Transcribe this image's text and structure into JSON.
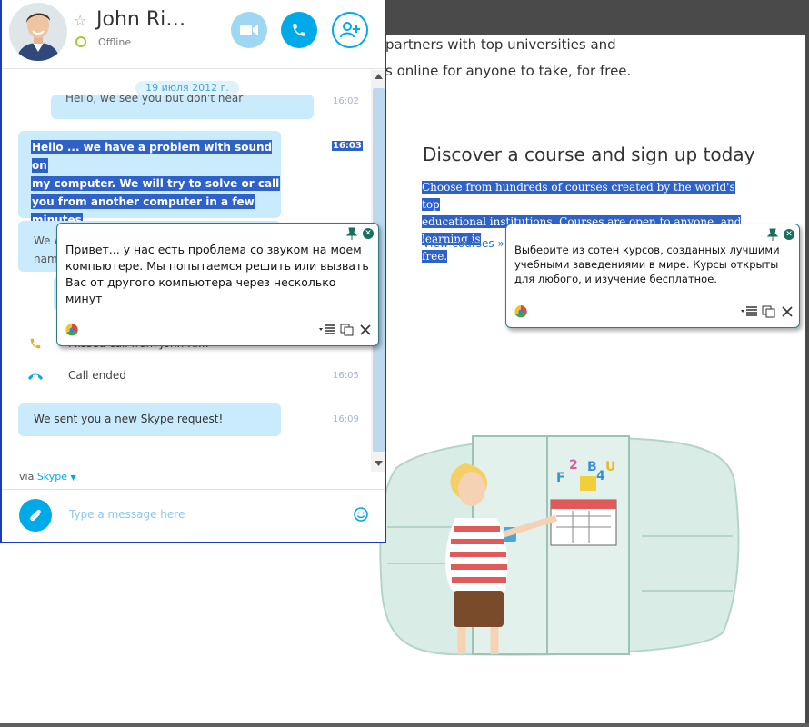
{
  "web": {
    "line1": "partners with top universities and",
    "line2": "s online for anyone to take, for free.",
    "heading": "Discover a course and sign up today",
    "description_lines": [
      "Choose from hundreds of courses created by the world's top",
      "educational institutions. Courses are open to anyone, and learning is",
      "free."
    ],
    "link": "View courses »",
    "magnet_letters": [
      "F",
      "2",
      "B",
      "4",
      "U"
    ]
  },
  "skype": {
    "contact_name": "John Ri…",
    "status": "Offline",
    "date": "19 июля 2012 г.",
    "messages": {
      "top_partial": "Hello, we see you but don't hear",
      "top_partial_time": "16:02",
      "selected_lines": [
        "Hello ... we have a problem with sound on",
        "my computer. We will try to solve or call",
        "you from another computer in a few",
        "minutes"
      ],
      "selected_time": "16:03",
      "mid_lines": [
        "We w",
        "nam"
      ],
      "call_missed": "Missed call from John Ri…",
      "call_ended": "Call ended",
      "call_ended_time": "16:05",
      "request": "We sent you a new Skype request!",
      "request_time": "16:09"
    },
    "via_prefix": "via",
    "via_link": "Skype",
    "input_placeholder": "Type a message here"
  },
  "translator": {
    "popup1_lines": [
      "Привет... у нас есть проблема со звуком на моем",
      "компьютере. Мы попытаемся решить или вызвать",
      "Вас от другого компьютера через несколько",
      "минут"
    ],
    "popup2_lines": [
      "Выберите из сотен курсов, созданных лучшими",
      "учебными заведениями в мире. Курсы открыты",
      "для любого, и изучение бесплатное."
    ]
  },
  "colors": {
    "skype_blue": "#00a9e8",
    "bubble": "#c9ebfb",
    "selection": "#2e62c9",
    "window_border": "#1b3dba",
    "status_offline": "#a8c732",
    "missed_call": "#f5a623"
  }
}
